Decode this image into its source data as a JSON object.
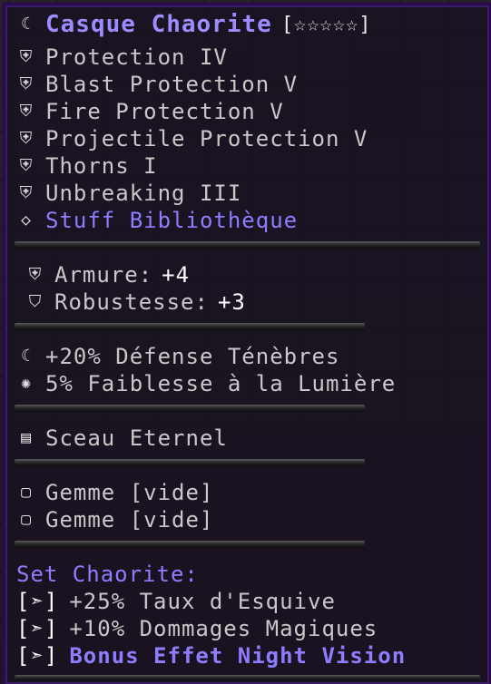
{
  "tooltip": {
    "title": "Casque Chaorite",
    "stars": "[☆☆☆☆☆]",
    "enchantments": [
      "Protection IV",
      "Blast Protection V",
      "Fire Protection V",
      "Projectile Protection V",
      "Thorns I",
      "Unbreaking III"
    ],
    "collection": "Stuff Bibliothèque",
    "stats": [
      {
        "label": "Armure:",
        "value": "+4"
      },
      {
        "label": "Robustesse:",
        "value": "+3"
      }
    ],
    "bonuses": [
      "+20% Défense Ténèbres",
      "5% Faiblesse à la Lumière"
    ],
    "seal": "Sceau Eternel",
    "gems": [
      "Gemme [vide]",
      "Gemme [vide]"
    ],
    "set": {
      "title": "Set Chaorite:",
      "tag": "[➣]",
      "bonuses": [
        "+25% Taux d'Esquive",
        "+10% Dommages Magiques",
        "Bonus Effet Night Vision"
      ]
    },
    "icons": {
      "title": "moon-icon",
      "enchant": "shield-icon",
      "collection": "diamond-icon",
      "armor": "shield-icon",
      "seal": "seal-icon",
      "gem": "empty-gem-icon"
    },
    "colors": {
      "title": "#9d8cff",
      "purple": "#8f7dff",
      "text": "#c8c8c8"
    }
  }
}
